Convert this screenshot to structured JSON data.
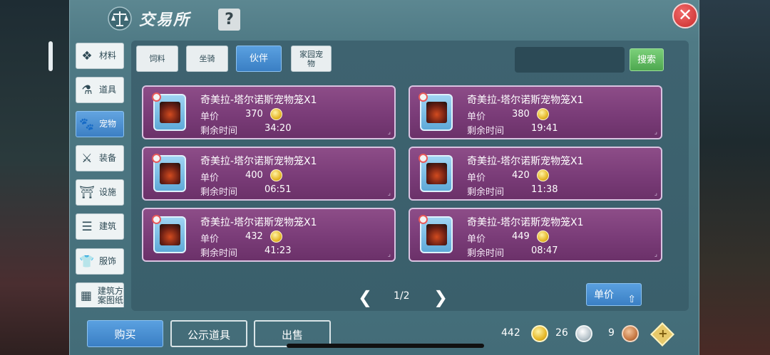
{
  "window": {
    "title": "交易所",
    "help": "?",
    "close": "✕"
  },
  "sidebar": {
    "items": [
      {
        "label": "材料",
        "icon": "materials-icon",
        "glyph": "❖",
        "active": false
      },
      {
        "label": "道具",
        "icon": "potion-icon",
        "glyph": "⚗",
        "active": false
      },
      {
        "label": "宠物",
        "icon": "paw-icon",
        "glyph": "🐾",
        "active": true
      },
      {
        "label": "装备",
        "icon": "equipment-icon",
        "glyph": "⚔",
        "active": false
      },
      {
        "label": "设施",
        "icon": "facility-icon",
        "glyph": "⛩",
        "active": false
      },
      {
        "label": "建筑",
        "icon": "building-icon",
        "glyph": "☰",
        "active": false
      },
      {
        "label": "服饰",
        "icon": "clothing-icon",
        "glyph": "👕",
        "active": false
      },
      {
        "label": "建筑方案图纸",
        "icon": "blueprint-icon",
        "glyph": "▦",
        "active": false
      }
    ]
  },
  "tabs": [
    {
      "label": "饲料",
      "active": false
    },
    {
      "label": "坐骑",
      "active": false
    },
    {
      "label": "伙伴",
      "active": true
    },
    {
      "label": "家园宠物",
      "active": false
    }
  ],
  "search": {
    "placeholder": "",
    "button": "搜索"
  },
  "listing_labels": {
    "price": "单价",
    "time_left": "剩余时间"
  },
  "listings": [
    {
      "name": "奇美拉-塔尔诺斯宠物笼X1",
      "price": "370",
      "time": "34:20"
    },
    {
      "name": "奇美拉-塔尔诺斯宠物笼X1",
      "price": "380",
      "time": "19:41"
    },
    {
      "name": "奇美拉-塔尔诺斯宠物笼X1",
      "price": "400",
      "time": "06:51"
    },
    {
      "name": "奇美拉-塔尔诺斯宠物笼X1",
      "price": "420",
      "time": "11:38"
    },
    {
      "name": "奇美拉-塔尔诺斯宠物笼X1",
      "price": "432",
      "time": "41:23"
    },
    {
      "name": "奇美拉-塔尔诺斯宠物笼X1",
      "price": "449",
      "time": "08:47"
    }
  ],
  "pagination": {
    "page": "1/2",
    "prev": "❮",
    "next": "❯"
  },
  "sort": {
    "label": "单价"
  },
  "bottom": {
    "buy": "购买",
    "public": "公示道具",
    "sell": "出售"
  },
  "currency": {
    "gold": "442",
    "silver": "26",
    "copper": "9",
    "add": "+"
  },
  "colors": {
    "accent": "#3a7fc4",
    "card": "#7a3c78",
    "panel": "#4f7a85"
  }
}
